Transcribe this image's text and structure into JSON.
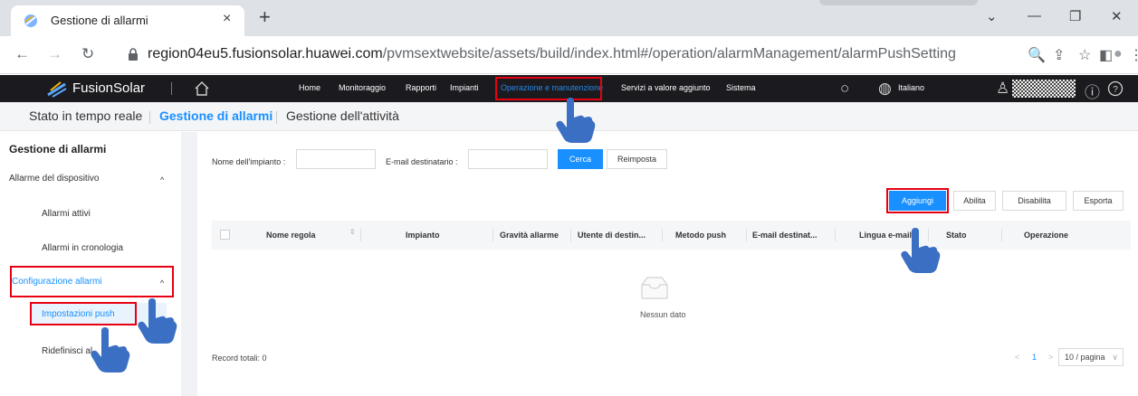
{
  "browser": {
    "tab_title": "Gestione di allarmi",
    "tab_close": "×",
    "new_tab": "+",
    "url_host": "region04eu5.fusionsolar.huawei.com",
    "url_path": "/pvmsextwebsite/assets/build/index.html#/operation/alarmManagement/alarmPushSetting",
    "window_controls": [
      "⌄",
      "—",
      "❐",
      "✕"
    ],
    "nav": {
      "back": "←",
      "forward": "→",
      "reload": "↻"
    },
    "toolbar_icons": [
      "🔍",
      "⇪",
      "☆",
      "◧",
      "●",
      "⋮"
    ]
  },
  "header": {
    "brand": "FusionSolar",
    "menu": [
      "Home",
      "Monitoraggio",
      "Rapporti",
      "Impianti",
      "Operazione e manutenzione",
      "Servizi a valore aggiunto",
      "Sistema"
    ],
    "active_menu": "Operazione e manutenzione",
    "language": "Italiano",
    "icons": {
      "search": "○",
      "globe": "◍",
      "user": "♙",
      "info": "ⓘ",
      "help": "?"
    }
  },
  "breadcrumb": {
    "items": [
      "Stato in tempo reale",
      "Gestione di allarmi",
      "Gestione dell'attività"
    ],
    "active_index": 1
  },
  "sidebar": {
    "title": "Gestione di allarmi",
    "groups": [
      {
        "label": "Allarme del dispositivo",
        "expanded": true,
        "items": [
          "Allarmi attivi",
          "Allarmi in cronologia"
        ]
      },
      {
        "label": "Configurazione allarmi",
        "expanded": true,
        "items": [
          "Impostazioni push",
          "Ridefinisci al"
        ]
      }
    ],
    "selected": "Impostazioni push",
    "chevron": "^"
  },
  "filters": {
    "plant_label": "Nome dell'impianto :",
    "plant_value": "",
    "email_label": "E-mail destinatario :",
    "email_value": "",
    "search_button": "Cerca",
    "reset_button": "Reimposta"
  },
  "actions": {
    "add": "Aggiungi",
    "enable": "Abilita",
    "disable": "Disabilita",
    "export": "Esporta"
  },
  "table": {
    "columns": [
      "Nome regola",
      "Impianto",
      "Gravità allarme",
      "Utente di destin...",
      "Metodo push",
      "E-mail destinat...",
      "Lingua e-mail",
      "Stato",
      "Operazione"
    ],
    "sort_icon": "⇕",
    "empty_text": "Nessun dato",
    "rows": []
  },
  "footer": {
    "total": "Record totali: 0",
    "prev": "<",
    "page": "1",
    "next": ">",
    "page_size": "10 / pagina",
    "page_size_caret": "∨"
  },
  "colors": {
    "accent": "#1890ff",
    "highlight": "#e60012",
    "header_bg": "#1b1b1f",
    "hand": "#3a6fc4"
  }
}
